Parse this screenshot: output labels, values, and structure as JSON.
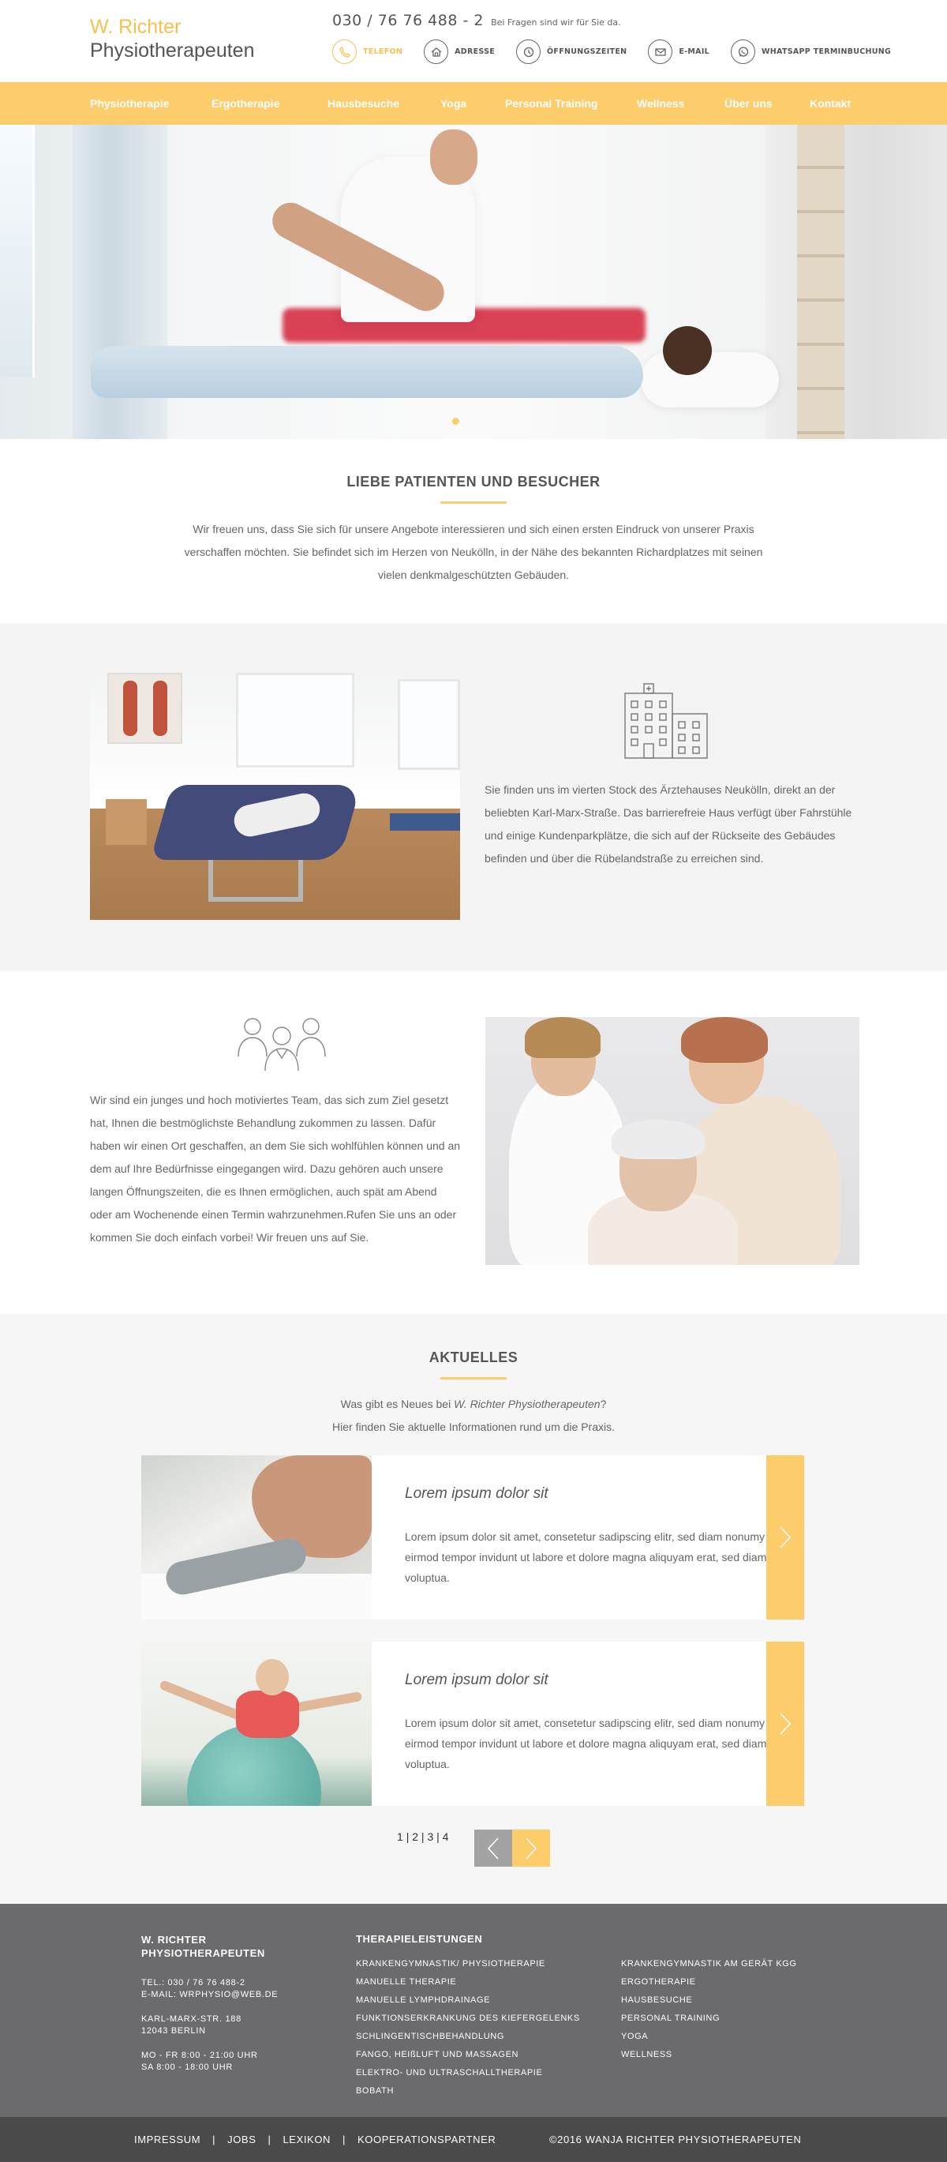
{
  "header": {
    "logo_line1": "W. Richter",
    "logo_line2": "Physiotherapeuten",
    "phone": "030 / 76 76 488 - 2",
    "phone_note": "Bei Fragen sind wir für Sie da.",
    "contacts": [
      {
        "label": "TELEFON",
        "icon": "phone-icon",
        "active": true
      },
      {
        "label": "ADRESSE",
        "icon": "house-icon"
      },
      {
        "label": "ÖFFNUNGSZEITEN",
        "icon": "clock-icon"
      },
      {
        "label": "E-MAIL",
        "icon": "mail-icon"
      },
      {
        "label": "WHATSAPP TERMINBUCHUNG",
        "icon": "whatsapp-icon"
      }
    ]
  },
  "nav": {
    "items": [
      "Physiotherapie",
      "Ergotherapie",
      "Hausbesuche",
      "Yoga",
      "Personal Training",
      "Wellness",
      "Über uns",
      "Kontakt"
    ]
  },
  "intro": {
    "title": "LIEBE PATIENTEN UND BESUCHER",
    "text": "Wir freuen uns, dass Sie sich für unsere Angebote interessieren und sich einen ersten Eindruck von unserer Praxis verschaffen möchten. Sie befindet sich im Herzen von Neukölln, in der Nähe des bekannten Richardplatzes mit seinen vielen denkmalgeschützten Gebäuden."
  },
  "location": {
    "icon": "building-icon",
    "text": "Sie finden uns im vierten Stock des Ärztehauses Neukölln, direkt an der beliebten Karl-Marx-Straße. Das barrierefreie Haus verfügt über Fahrstühle und einige Kundenparkplätze, die sich auf der Rückseite des Gebäudes befinden und über die Rübelandstraße zu erreichen sind."
  },
  "team": {
    "icon": "team-icon",
    "text": "Wir sind ein junges und hoch motiviertes Team, das sich zum Ziel gesetzt hat, Ihnen die bestmöglichste Behandlung zukommen zu lassen. Dafür haben wir einen Ort geschaffen, an dem Sie sich wohlfühlen können und an dem auf Ihre Bedürfnisse eingegangen wird. Dazu gehören auch unsere langen Öffnungszeiten, die es Ihnen ermöglichen, auch spät am Abend oder am Wochenende einen Termin wahrzunehmen.Rufen Sie uns an oder kommen Sie doch einfach vorbei! Wir freuen uns auf Sie."
  },
  "news": {
    "title": "AKTUELLES",
    "intro_pre": "Was gibt es Neues bei ",
    "intro_em": "W. Richter Physiotherapeuten",
    "intro_post": "?",
    "intro_line2": "Hier finden Sie aktuelle Informationen rund um die Praxis.",
    "items": [
      {
        "title": "Lorem ipsum dolor sit",
        "text": "Lorem ipsum dolor sit amet, consetetur sadipscing elitr, sed diam nonumy eirmod tempor invidunt ut labore et dolore magna aliquyam erat, sed diam voluptua."
      },
      {
        "title": "Lorem ipsum dolor sit",
        "text": "Lorem ipsum dolor sit amet, consetetur sadipscing elitr, sed diam nonumy eirmod tempor invidunt ut labore et dolore magna aliquyam erat, sed diam voluptua."
      }
    ],
    "pages": [
      "1",
      "2",
      "3",
      "4"
    ],
    "page_sep": "|"
  },
  "footer": {
    "brand_line1": "W. RICHTER",
    "brand_line2": "PHYSIOTHERAPEUTEN",
    "tel": "TEL.: 030 / 76 76 488-2",
    "email": "E-MAIL: WRPHYSIO@WEB.DE",
    "street": "KARL-MARX-STR. 188",
    "city": "12043 BERLIN",
    "hours1": "MO - FR 8:00 - 21:00 UHR",
    "hours2": "SA 8:00 - 18:00 UHR",
    "services_title": "THERAPIELEISTUNGEN",
    "services_col1": [
      "KRANKENGYMNASTIK/ PHYSIOTHERAPIE",
      "MANUELLE THERAPIE",
      "MANUELLE LYMPHDRAINAGE",
      "FUNKTIONSERKRANKUNG DES KIEFERGELENKS",
      "SCHLINGENTISCHBEHANDLUNG",
      "FANGO, HEIßLUFT UND MASSAGEN",
      "ELEKTRO- UND ULTRASCHALLTHERAPIE",
      "BOBATH"
    ],
    "services_col2": [
      "KRANKENGYMNASTIK AM GERÄT KGG",
      "ERGOTHERAPIE",
      "HAUSBESUCHE",
      "PERSONAL TRAINING",
      "YOGA",
      "WELLNESS"
    ]
  },
  "bottom": {
    "links": [
      "IMPRESSUM",
      "JOBS",
      "LEXIKON",
      "KOOPERATIONSPARTNER"
    ],
    "separator": "|",
    "copyright": "©2016 WANJA RICHTER PHYSIOTHERAPEUTEN"
  },
  "colors": {
    "accent": "#fecd6b",
    "logo_accent": "#f7c14e",
    "footer": "#6b6a6c",
    "footer_bottom": "#4a4a4b"
  }
}
